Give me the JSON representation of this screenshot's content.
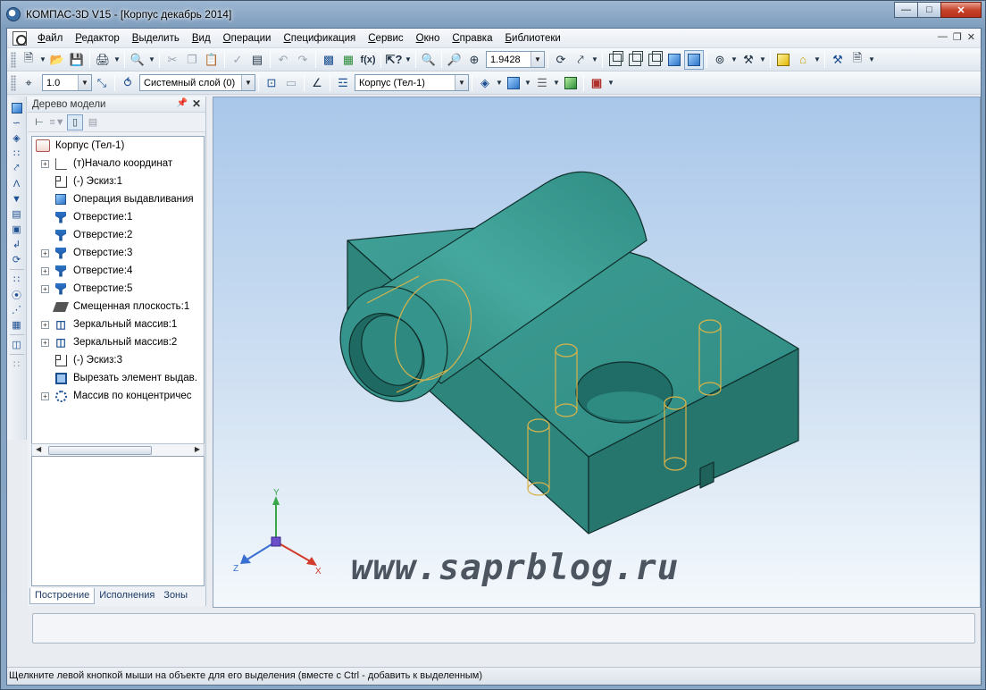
{
  "window": {
    "title": "КОМПАС-3D V15 - [Корпус декабрь 2014]",
    "controls": [
      "minimize",
      "maximize",
      "close"
    ]
  },
  "menu": {
    "items": [
      "Файл",
      "Редактор",
      "Выделить",
      "Вид",
      "Операции",
      "Спецификация",
      "Сервис",
      "Окно",
      "Справка",
      "Библиотеки"
    ]
  },
  "toolbar": {
    "zoom_value": "1.9428"
  },
  "properties_bar": {
    "step_value": "1.0",
    "layer_value": "Системный слой (0)",
    "body_value": "Корпус (Тел-1)"
  },
  "tree_panel": {
    "title": "Дерево модели",
    "root_label": "Корпус (Тел-1)",
    "items": [
      {
        "label": "(т)Начало координат",
        "icon": "axis-icon",
        "expandable": true
      },
      {
        "label": "(-) Эскиз:1",
        "icon": "sketch-icon",
        "expandable": false
      },
      {
        "label": "Операция выдавливания",
        "icon": "extrude-icon",
        "expandable": false
      },
      {
        "label": "Отверстие:1",
        "icon": "hole-icon",
        "expandable": false
      },
      {
        "label": "Отверстие:2",
        "icon": "hole-icon",
        "expandable": false
      },
      {
        "label": "Отверстие:3",
        "icon": "hole-icon",
        "expandable": true
      },
      {
        "label": "Отверстие:4",
        "icon": "hole-icon",
        "expandable": true
      },
      {
        "label": "Отверстие:5",
        "icon": "hole-icon",
        "expandable": true
      },
      {
        "label": "Смещенная плоскость:1",
        "icon": "plane-icon",
        "expandable": false
      },
      {
        "label": "Зеркальный массив:1",
        "icon": "mirror-icon",
        "expandable": true
      },
      {
        "label": "Зеркальный массив:2",
        "icon": "mirror-icon",
        "expandable": true
      },
      {
        "label": "(-) Эскиз:3",
        "icon": "sketch-icon",
        "expandable": false
      },
      {
        "label": "Вырезать элемент выдав.",
        "icon": "cut-extrude-icon",
        "expandable": false
      },
      {
        "label": "Массив по концентричес",
        "icon": "circular-array-icon",
        "expandable": true
      }
    ],
    "tabs": [
      "Построение",
      "Исполнения",
      "Зоны"
    ],
    "active_tab": "Построение"
  },
  "viewport": {
    "watermark": "www.saprblog.ru",
    "axes": {
      "x": "X",
      "y": "Y",
      "z": "Z"
    },
    "model_color": "#3a9c93",
    "background_top": "#a9c7ea",
    "background_bottom": "#f4f8fc"
  },
  "status": {
    "hint": "Щелкните левой кнопкой мыши на объекте для его выделения (вместе с Ctrl - добавить к выделенным)"
  }
}
